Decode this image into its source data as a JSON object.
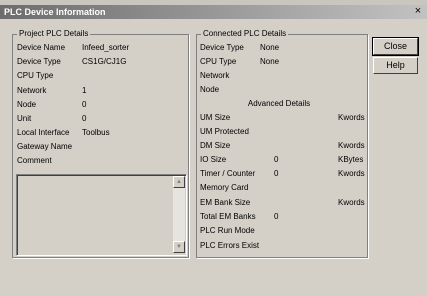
{
  "window": {
    "title": "PLC Device Information",
    "close_glyph": "×",
    "close_icon": "close-icon"
  },
  "project": {
    "title": "Project PLC Details",
    "rows": [
      {
        "label": "Device Name",
        "value": "Infeed_sorter"
      },
      {
        "label": "Device Type",
        "value": "CS1G/CJ1G"
      },
      {
        "label": "CPU Type",
        "value": ""
      },
      {
        "label": "Network",
        "value": "1"
      },
      {
        "label": "Node",
        "value": "0"
      },
      {
        "label": "Unit",
        "value": "0"
      },
      {
        "label": "Local Interface",
        "value": "Toolbus"
      },
      {
        "label": "Gateway Name",
        "value": ""
      },
      {
        "label": "Comment",
        "value": ""
      }
    ],
    "comment_text": "",
    "scroll_up_glyph": "▲",
    "scroll_down_glyph": "▼"
  },
  "connected": {
    "title": "Connected PLC Details",
    "rows": [
      {
        "label": "Device Type",
        "value": "None",
        "unit": ""
      },
      {
        "label": "CPU Type",
        "value": "None",
        "unit": ""
      },
      {
        "label": "Network",
        "value": "",
        "unit": ""
      },
      {
        "label": "Node",
        "value": "",
        "unit": ""
      }
    ],
    "advanced_heading": "Advanced Details",
    "advanced_rows": [
      {
        "label": "UM Size",
        "value": "",
        "unit": "Kwords"
      },
      {
        "label": "UM Protected",
        "value": "",
        "unit": ""
      },
      {
        "label": "DM Size",
        "value": "",
        "unit": "Kwords"
      },
      {
        "label": "IO Size",
        "value": "0",
        "unit": "KBytes"
      },
      {
        "label": "Timer / Counter",
        "value": "0",
        "unit": "Kwords"
      },
      {
        "label": "Memory Card",
        "value": "",
        "unit": ""
      },
      {
        "label": "EM Bank Size",
        "value": "",
        "unit": "Kwords"
      },
      {
        "label": "Total EM Banks",
        "value": "0",
        "unit": ""
      },
      {
        "label": "PLC Run Mode",
        "value": "",
        "unit": ""
      },
      {
        "label": "PLC Errors Exist",
        "value": "",
        "unit": ""
      }
    ]
  },
  "buttons": {
    "close_label": "Close",
    "help_label": "Help"
  }
}
